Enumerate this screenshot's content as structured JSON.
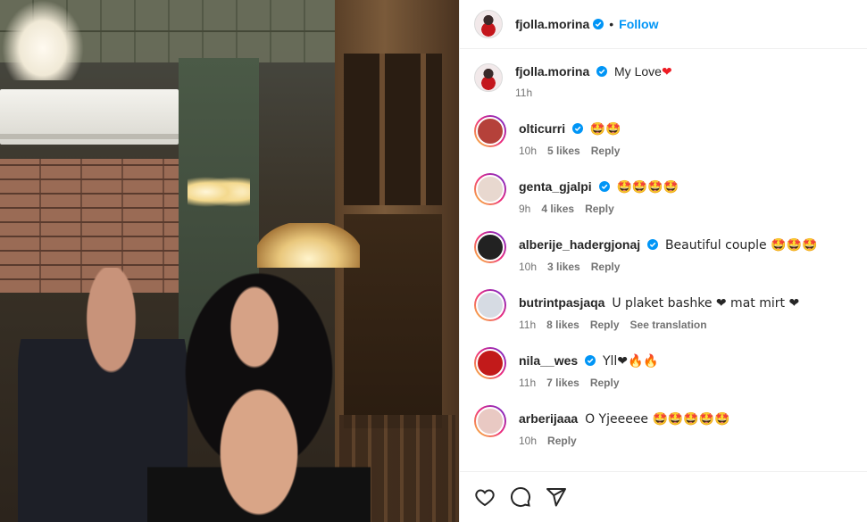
{
  "header": {
    "username": "fjolla.morina",
    "separator": "•",
    "follow_label": "Follow"
  },
  "caption": {
    "username": "fjolla.morina",
    "text": "My Love",
    "heart": "❤",
    "time": "11h"
  },
  "comments": [
    {
      "username": "olticurri",
      "verified": true,
      "text": "🤩🤩",
      "time": "10h",
      "likes": "5 likes",
      "reply": "Reply"
    },
    {
      "username": "genta_gjalpi",
      "verified": true,
      "text": "🤩🤩🤩🤩",
      "time": "9h",
      "likes": "4 likes",
      "reply": "Reply"
    },
    {
      "username": "alberije_hadergjonaj",
      "verified": true,
      "text": "Beautiful couple 🤩🤩🤩",
      "time": "10h",
      "likes": "3 likes",
      "reply": "Reply"
    },
    {
      "username": "butrintpasjaqa",
      "verified": false,
      "text": "U plaket bashke ❤ mat mirt ❤",
      "time": "11h",
      "likes": "8 likes",
      "reply": "Reply",
      "translate": "See translation"
    },
    {
      "username": "nila__wes",
      "verified": true,
      "text": "Yll❤🔥🔥",
      "time": "11h",
      "likes": "7 likes",
      "reply": "Reply"
    },
    {
      "username": "arberijaaa",
      "verified": false,
      "text": "O Yjeeeee 🤩🤩🤩🤩🤩",
      "time": "10h",
      "likes": "",
      "reply": "Reply"
    }
  ],
  "colors": {
    "accent": "#0095f6",
    "verified": "#0095f6",
    "heart": "#ed1c24"
  },
  "icons": {
    "like": "heart-outline-icon",
    "comment": "comment-bubble-icon",
    "share": "paper-plane-icon"
  }
}
